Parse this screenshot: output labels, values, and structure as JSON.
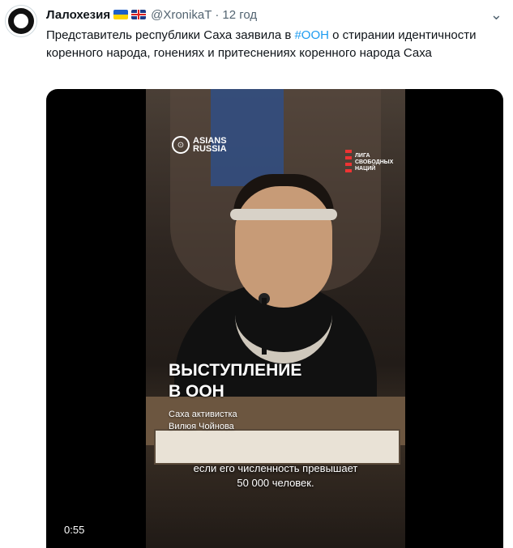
{
  "tweet": {
    "author_name": "Лалохезия",
    "author_flags": [
      "ukraine-flag",
      "uk-flag"
    ],
    "handle": "@XronikaT",
    "separator": "·",
    "time": "12 год",
    "more_icon": "more-icon",
    "text_before": "Представитель республики Саха заявила в ",
    "hashtag": "#ООН",
    "text_after": " о стирании идентичности коренного народа, гонениях и притеснениях коренного народа Саха"
  },
  "video": {
    "logo_left_line1": "ASIANS",
    "logo_left_line2": "RUSSIA",
    "logo_right_line1": "ЛИГА",
    "logo_right_line2": "СВОБОДНЫХ",
    "logo_right_line3": "НАЦИЙ",
    "title_line1": "ВЫСТУПЛЕНИЕ",
    "title_line2": "В ООН",
    "subtitle_line1": "Саха активистка",
    "subtitle_line2": "Вилюя Чойнова",
    "caption_line1": "если его численность превышает",
    "caption_line2": "50 000 человек.",
    "duration": "0:55"
  },
  "colors": {
    "link": "#1d9bf0",
    "secondary_text": "#536471",
    "primary_text": "#0f1419"
  }
}
